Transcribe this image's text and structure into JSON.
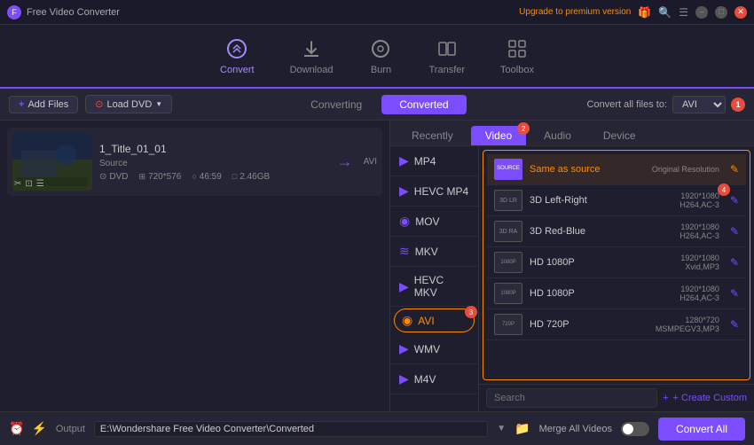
{
  "titleBar": {
    "appName": "Free Video Converter",
    "upgradeText": "Upgrade to premium version"
  },
  "topNav": {
    "items": [
      {
        "id": "convert",
        "label": "Convert",
        "icon": "⟳",
        "active": true
      },
      {
        "id": "download",
        "label": "Download",
        "icon": "↓",
        "active": false
      },
      {
        "id": "burn",
        "label": "Burn",
        "icon": "⊙",
        "active": false
      },
      {
        "id": "transfer",
        "label": "Transfer",
        "icon": "⇄",
        "active": false
      },
      {
        "id": "toolbox",
        "label": "Toolbox",
        "icon": "▦",
        "active": false
      }
    ]
  },
  "toolbar": {
    "addFilesLabel": "+ Add Files",
    "loadDvdLabel": "Load DVD",
    "tabs": [
      {
        "label": "Converting",
        "active": false
      },
      {
        "label": "Converted",
        "active": false
      }
    ],
    "convertAllLabel": "Convert all files to:",
    "formatValue": "AVI",
    "badgeNum": "1"
  },
  "fileItem": {
    "name": "1_Title_01_01",
    "sourceLabel": "Source",
    "sourceMedium": "DVD",
    "resolution": "720*576",
    "duration": "46:59",
    "size": "2.46GB"
  },
  "formatPanel": {
    "tabs": [
      {
        "label": "Recently",
        "active": false
      },
      {
        "label": "Video",
        "active": true,
        "badge": "2"
      },
      {
        "label": "Audio",
        "active": false
      },
      {
        "label": "Device",
        "active": false
      }
    ],
    "formats": [
      {
        "id": "mp4",
        "label": "MP4",
        "icon": "▶"
      },
      {
        "id": "hevc-mp4",
        "label": "HEVC MP4",
        "icon": "▶"
      },
      {
        "id": "mov",
        "label": "MOV",
        "icon": "◉"
      },
      {
        "id": "mkv",
        "label": "MKV",
        "icon": "≋"
      },
      {
        "id": "hevc-mkv",
        "label": "HEVC MKV",
        "icon": "▶"
      },
      {
        "id": "avi",
        "label": "AVI",
        "active": true,
        "icon": "◉",
        "badge": "3"
      },
      {
        "id": "wmv",
        "label": "WMV",
        "icon": "▶"
      },
      {
        "id": "m4v",
        "label": "M4V",
        "icon": "▶"
      }
    ],
    "resolutions": [
      {
        "id": "same-as-source",
        "name": "Same as source",
        "spec1": "Original Resolution",
        "iconType": "source",
        "iconText": "SOURCE",
        "highlighted": true,
        "editOrange": true
      },
      {
        "id": "3d-lr",
        "name": "3D Left-Right",
        "spec1": "1920*1080",
        "spec2": "H264,AC-3",
        "iconText": "3D LR",
        "badge": "4"
      },
      {
        "id": "3d-rb",
        "name": "3D Red-Blue",
        "spec1": "1920*1080",
        "spec2": "H264,AC-3",
        "iconText": "3D RA"
      },
      {
        "id": "hd-1080p-xvid",
        "name": "HD 1080P",
        "spec1": "1920*1080",
        "spec2": "Xvid,MP3",
        "iconText": "1080P"
      },
      {
        "id": "hd-1080p-h264",
        "name": "HD 1080P",
        "spec1": "1920*1080",
        "spec2": "H264,AC-3",
        "iconText": "1080P"
      },
      {
        "id": "hd-720p",
        "name": "HD 720P",
        "spec1": "1280*720",
        "spec2": "MSMPEGV3,MP3",
        "iconText": "720P"
      }
    ],
    "searchPlaceholder": "Search",
    "createCustomLabel": "+ Create Custom"
  },
  "bottomBar": {
    "outputLabel": "Output",
    "outputPath": "E:\\Wondershare Free Video Converter\\Converted",
    "mergeLabel": "Merge All Videos",
    "convertAllLabel": "Convert All"
  }
}
